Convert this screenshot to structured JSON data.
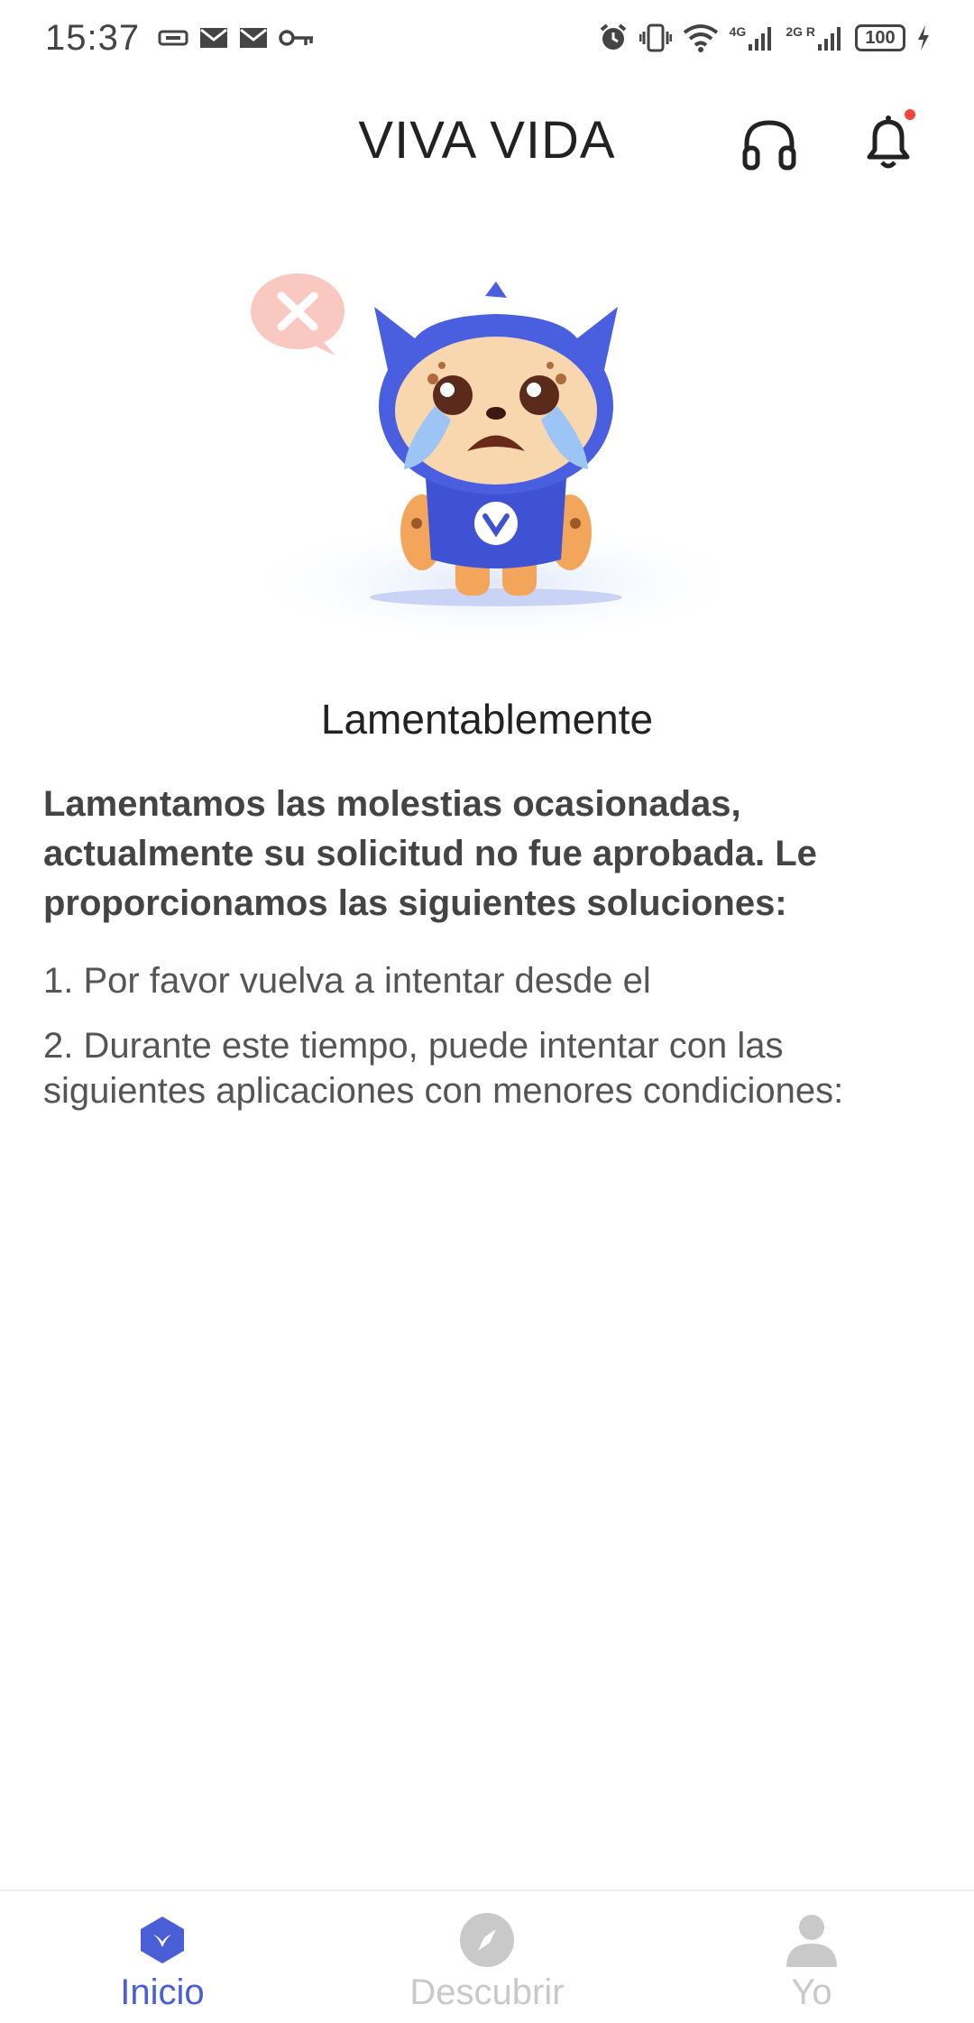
{
  "status_bar": {
    "time": "15:37",
    "network_4g": "4G",
    "network_2g": "2G R",
    "battery": "100"
  },
  "header": {
    "title": "VIVA VIDA"
  },
  "colors": {
    "accent": "#4a5fd6",
    "notification_dot": "#f0463c",
    "inactive": "#c9c9c9"
  },
  "main": {
    "title": "Lamentablemente",
    "description": "Lamentamos las molestias ocasionadas, actualmente su solicitud no fue aprobada. Le proporcionamos las siguientes soluciones:",
    "steps": [
      "1. Por favor vuelva a intentar desde el",
      "2. Durante este tiempo, puede intentar con las siguientes aplicaciones con menores condiciones:"
    ]
  },
  "bottom_nav": {
    "items": [
      {
        "label": "Inicio",
        "icon": "home-icon",
        "active": true
      },
      {
        "label": "Descubrir",
        "icon": "compass-icon",
        "active": false
      },
      {
        "label": "Yo",
        "icon": "person-icon",
        "active": false
      }
    ]
  }
}
